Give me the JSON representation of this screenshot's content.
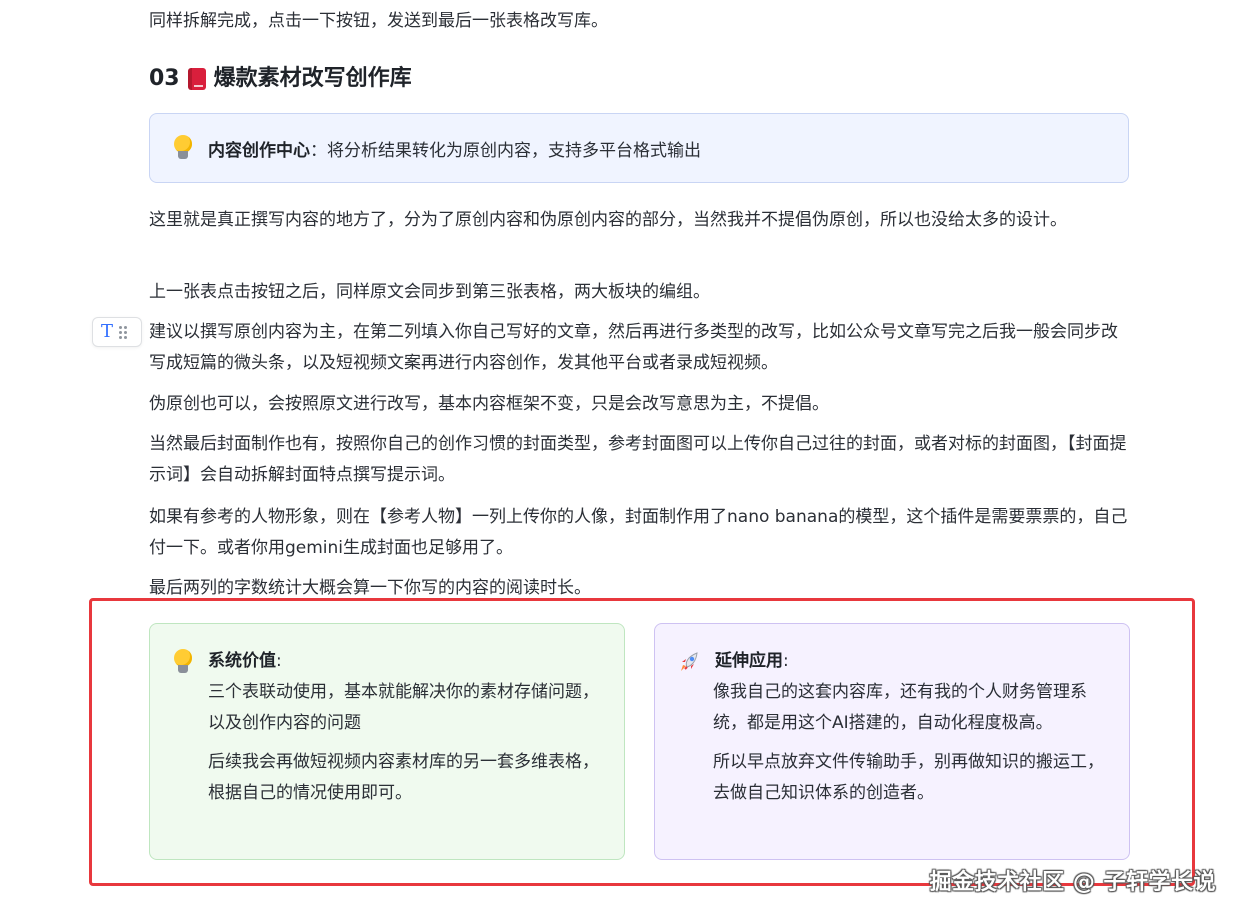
{
  "intro_line": "同样拆解完成，点击一下按钮，发送到最后一张表格改写库。",
  "section": {
    "number": "03",
    "title": "爆款素材改写创作库"
  },
  "callout": {
    "label": "内容创作中心",
    "text": "：将分析结果转化为原创内容，支持多平台格式输出"
  },
  "paragraphs": [
    "这里就是真正撰写内容的地方了，分为了原创内容和伪原创内容的部分，当然我并不提倡伪原创，所以也没给太多的设计。",
    "上一张表点击按钮之后，同样原文会同步到第三张表格，两大板块的编组。",
    "建议以撰写原创内容为主，在第二列填入你自己写好的文章，然后再进行多类型的改写，比如公众号文章写完之后我一般会同步改写成短篇的微头条，以及短视频文案再进行内容创作，发其他平台或者录成短视频。",
    "伪原创也可以，会按照原文进行改写，基本内容框架不变，只是会改写意思为主，不提倡。",
    "当然最后封面制作也有，按照你自己的创作习惯的封面类型，参考封面图可以上传你自己过往的封面，或者对标的封面图，【封面提示词】会自动拆解封面特点撰写提示词。",
    "如果有参考的人物形象，则在【参考人物】一列上传你的人像，封面制作用了nano banana的模型，这个插件是需要票票的，自己付一下。或者你用gemini生成封面也足够用了。",
    "最后两列的字数统计大概会算一下你写的内容的阅读时长。"
  ],
  "block_handle": {
    "glyph": "T"
  },
  "cards": {
    "value": {
      "title": "系统价值",
      "colon": ":",
      "lines": [
        "三个表联动使用，基本就能解决你的素材存储问题，以及创作内容的问题",
        "后续我会再做短视频内容素材库的另一套多维表格，根据自己的情况使用即可。"
      ]
    },
    "extend": {
      "title": "延伸应用",
      "colon": ":",
      "lines": [
        "像我自己的这套内容库，还有我的个人财务管理系统，都是用这个AI搭建的，自动化程度极高。",
        "所以早点放弃文件传输助手，别再做知识的搬运工，去做自己知识体系的创造者。"
      ]
    }
  },
  "watermark": "掘金技术社区 @ 子轩学长说",
  "icons": {
    "callout": "lightbulb-icon",
    "section": "red-book-icon",
    "card_value": "lightbulb-icon",
    "card_extend": "rocket-icon",
    "handle": "text-type-icon"
  },
  "colors": {
    "highlight_border": "#e8383d",
    "callout_bg": "#f0f4ff",
    "green_card_bg": "#f0faef",
    "purple_card_bg": "#f6f2ff",
    "accent_blue": "#3370ff"
  }
}
